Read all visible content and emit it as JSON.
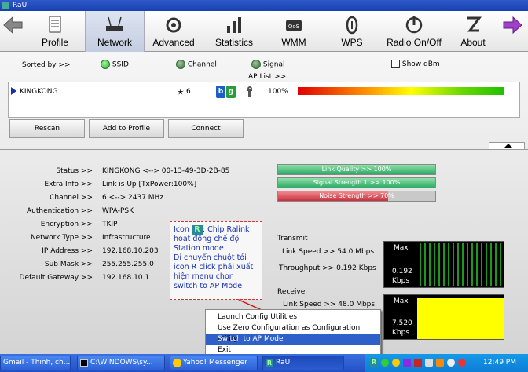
{
  "window": {
    "title": "RaUI"
  },
  "toolbar": {
    "items": [
      {
        "label": "Profile",
        "icon": "profile-icon"
      },
      {
        "label": "Network",
        "icon": "network-icon",
        "active": true
      },
      {
        "label": "Advanced",
        "icon": "advanced-icon"
      },
      {
        "label": "Statistics",
        "icon": "statistics-icon"
      },
      {
        "label": "WMM",
        "icon": "wmm-icon"
      },
      {
        "label": "WPS",
        "icon": "wps-icon"
      },
      {
        "label": "Radio On/Off",
        "icon": "radio-icon"
      },
      {
        "label": "About",
        "icon": "about-icon"
      }
    ]
  },
  "sort": {
    "label": "Sorted by >>",
    "ssid": "SSID",
    "channel": "Channel",
    "signal": "Signal",
    "show_dbm": "Show dBm",
    "ap_list": "AP List >>"
  },
  "ap": {
    "ssid": "KINGKONG",
    "channel": "6",
    "b": "b",
    "g": "g",
    "signal": "100%",
    "signal_fraction": 1.0
  },
  "buttons": {
    "rescan": "Rescan",
    "add": "Add to Profile",
    "connect": "Connect"
  },
  "status": {
    "labels": [
      "Status >>",
      "Extra Info >>",
      "Channel >>",
      "Authentication >>",
      "Encryption >>",
      "Network Type >>",
      "IP Address >>",
      "Sub Mask >>",
      "Default Gateway >>"
    ],
    "values": [
      "KINGKONG <--> 00-13-49-3D-2B-85",
      "Link is Up [TxPower:100%]",
      "6 <--> 2437 MHz",
      "WPA-PSK",
      "TKIP",
      "Infrastructure",
      "192.168.10.203",
      "255.255.255.0",
      "192.168.10.1"
    ]
  },
  "bars": {
    "link_quality": "Link Quality >> 100%",
    "link_quality_value": 100,
    "signal_strength": "Signal Strength 1 >> 100%",
    "signal_strength_value": 100,
    "noise_strength": "Noise Strength >> 70%",
    "noise_strength_value": 70
  },
  "transmit": {
    "title": "Transmit",
    "link_speed": "Link Speed >>  54.0 Mbps",
    "throughput": "Throughput >> 0.192 Kbps",
    "max": "Max",
    "value": "0.192",
    "unit": "Kbps"
  },
  "receive": {
    "title": "Receive",
    "link_speed": "Link Speed >> 48.0 Mbps",
    "throughput": "Throughput >> 7.520 Kbps",
    "max": "Max",
    "value": "7.520",
    "unit": "Kbps"
  },
  "note": {
    "p1": "Icon",
    "p2": ": Chip Ralink hoạt động chế độ Station mode",
    "p3": "Di chuyển chuột tới icon R click phải xuất hiện menu chon switch to AP Mode",
    "icon": "R"
  },
  "menu": {
    "items": [
      "Launch Config Utilities",
      "Use Zero Configuration as Configuration utility",
      "Switch to AP Mode",
      "Exit"
    ],
    "selected": 2
  },
  "taskbar": {
    "tasks": [
      "Gmail - Thinh, ch...",
      "C:\\WINDOWS\\sy...",
      "Yahoo! Messenger",
      "RaUI"
    ],
    "clock": "12:49 PM"
  },
  "colors": {
    "accent": "#2f5fc9",
    "green": "#2a9d3a",
    "yellow": "#ffff00"
  }
}
